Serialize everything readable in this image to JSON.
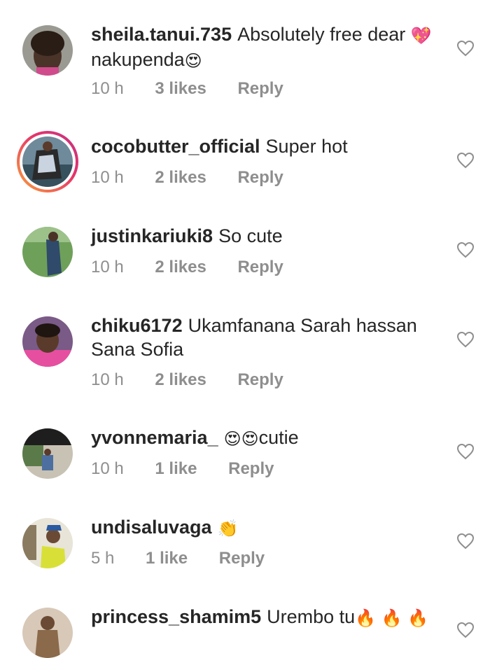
{
  "comments": [
    {
      "username": "sheila.tanui.735",
      "text": "Absolutely free dear",
      "emoji_after": "💖",
      "line2": "nakupenda",
      "emoji_line2": "😍",
      "time": "10 h",
      "likes": "3 likes",
      "reply": "Reply"
    },
    {
      "username": "cocobutter_official",
      "text": "Super hot",
      "time": "10 h",
      "likes": "2 likes",
      "reply": "Reply"
    },
    {
      "username": "justinkariuki8",
      "text": "So cute",
      "time": "10 h",
      "likes": "2 likes",
      "reply": "Reply"
    },
    {
      "username": "chiku6172",
      "text": "Ukamfanana Sarah hassan",
      "line2": "Sana Sofia",
      "time": "10 h",
      "likes": "2 likes",
      "reply": "Reply"
    },
    {
      "username": "yvonnemaria_",
      "emoji_before": "😍😍",
      "text": "cutie",
      "time": "10 h",
      "likes": "1 like",
      "reply": "Reply"
    },
    {
      "username": "undisaluvaga",
      "emoji_after": "👏",
      "time": "5 h",
      "likes": "1 like",
      "reply": "Reply"
    },
    {
      "username": "princess_shamim5",
      "text": "Urembo tu",
      "emoji_after": "🔥 🔥 🔥"
    }
  ],
  "icons": {
    "like": "heart-outline-icon"
  },
  "colors": {
    "text": "#262626",
    "meta": "#8e8e8e",
    "story_ring": "#e5336a"
  }
}
